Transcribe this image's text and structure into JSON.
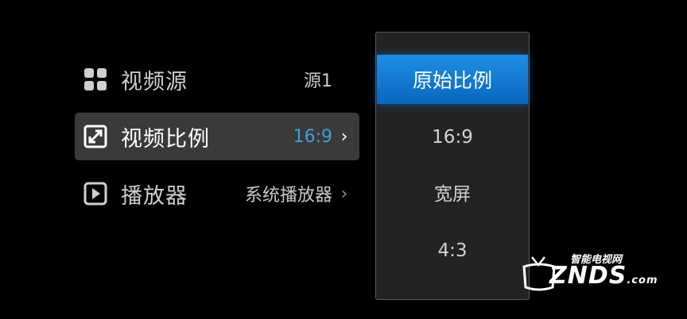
{
  "settings_menu": {
    "items": [
      {
        "label": "视频源",
        "value": "源1",
        "icon": "grid-icon",
        "chevron": ""
      },
      {
        "label": "视频比例",
        "value": "16:9",
        "icon": "aspect-ratio-icon",
        "chevron": "›"
      },
      {
        "label": "播放器",
        "value": "系统播放器",
        "icon": "play-icon",
        "chevron": "›"
      }
    ],
    "selected_index": 1
  },
  "aspect_popup": {
    "options": [
      "原始比例",
      "16:9",
      "宽屏",
      "4:3"
    ],
    "highlighted_index": 0
  },
  "watermark": {
    "cn_text": "智能电视网",
    "brand": "ZNDS",
    "suffix": ".com"
  },
  "colors": {
    "background": "#000000",
    "selected_row": "#3a3a3a",
    "accent_value": "#3f9ee0",
    "popup_highlight": "#0a7ad6"
  }
}
